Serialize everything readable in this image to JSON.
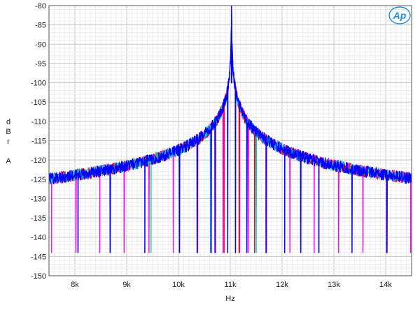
{
  "chart_data": {
    "type": "line",
    "title": "",
    "xlabel": "Hz",
    "ylabel_letters": [
      "d",
      "B",
      "r",
      "",
      "A"
    ],
    "xlim": [
      7500,
      14500
    ],
    "ylim": [
      -150,
      -80
    ],
    "x_ticks": [
      {
        "value": 8000,
        "label": "8k"
      },
      {
        "value": 9000,
        "label": "9k"
      },
      {
        "value": 10000,
        "label": "10k"
      },
      {
        "value": 11000,
        "label": "11k"
      },
      {
        "value": 12000,
        "label": "12k"
      },
      {
        "value": 13000,
        "label": "13k"
      },
      {
        "value": 14000,
        "label": "14k"
      }
    ],
    "y_ticks": [
      {
        "value": -80,
        "label": "-80"
      },
      {
        "value": -85,
        "label": "-85"
      },
      {
        "value": -90,
        "label": "-90"
      },
      {
        "value": -95,
        "label": "-95"
      },
      {
        "value": -100,
        "label": "-100"
      },
      {
        "value": -105,
        "label": "-105"
      },
      {
        "value": -110,
        "label": "-110"
      },
      {
        "value": -115,
        "label": "-115"
      },
      {
        "value": -120,
        "label": "-120"
      },
      {
        "value": -125,
        "label": "-125"
      },
      {
        "value": -130,
        "label": "-130"
      },
      {
        "value": -135,
        "label": "-135"
      },
      {
        "value": -140,
        "label": "-140"
      },
      {
        "value": -145,
        "label": "-145"
      },
      {
        "value": -150,
        "label": "-150"
      }
    ],
    "grid": true,
    "noise_floor": -145,
    "fundamental": {
      "x": 11025,
      "y": -80
    },
    "series": [
      {
        "color": "#ff00ff",
        "spikes": [
          {
            "x": 7550,
            "y": -124
          },
          {
            "x": 8020,
            "y": -125
          },
          {
            "x": 8480,
            "y": -125
          },
          {
            "x": 8950,
            "y": -126
          },
          {
            "x": 9430,
            "y": -127
          },
          {
            "x": 9900,
            "y": -127
          },
          {
            "x": 10370,
            "y": -127
          },
          {
            "x": 10700,
            "y": -134
          },
          {
            "x": 10860,
            "y": -132
          },
          {
            "x": 11180,
            "y": -130
          },
          {
            "x": 11350,
            "y": -127
          },
          {
            "x": 11700,
            "y": -127
          },
          {
            "x": 12150,
            "y": -128
          },
          {
            "x": 12620,
            "y": -129
          },
          {
            "x": 13090,
            "y": -129
          },
          {
            "x": 13560,
            "y": -129
          },
          {
            "x": 14030,
            "y": -128
          },
          {
            "x": 14480,
            "y": -128
          }
        ]
      },
      {
        "color": "#ff0000",
        "spikes": [
          {
            "x": 10620,
            "y": -134
          },
          {
            "x": 10880,
            "y": -134
          },
          {
            "x": 11170,
            "y": -134
          },
          {
            "x": 11470,
            "y": -137
          }
        ]
      },
      {
        "color": "#00c8c8",
        "spikes": [
          {
            "x": 9470,
            "y": -138
          },
          {
            "x": 10620,
            "y": -138
          },
          {
            "x": 11500,
            "y": -139
          }
        ]
      },
      {
        "color": "#0000ff",
        "spikes": [
          {
            "x": 8060,
            "y": -138
          },
          {
            "x": 8680,
            "y": -133
          },
          {
            "x": 9350,
            "y": -137
          },
          {
            "x": 10020,
            "y": -131
          },
          {
            "x": 10360,
            "y": -131
          },
          {
            "x": 10630,
            "y": -128
          },
          {
            "x": 10710,
            "y": -126
          },
          {
            "x": 10950,
            "y": -127
          },
          {
            "x": 11100,
            "y": -126
          },
          {
            "x": 11320,
            "y": -126
          },
          {
            "x": 11690,
            "y": -131
          },
          {
            "x": 12050,
            "y": -133
          },
          {
            "x": 12360,
            "y": -131
          },
          {
            "x": 12710,
            "y": -138
          },
          {
            "x": 13350,
            "y": -134
          },
          {
            "x": 14020,
            "y": -138
          }
        ]
      }
    ]
  },
  "logo": {
    "text": "Ap",
    "color": "#1e8fe0"
  }
}
